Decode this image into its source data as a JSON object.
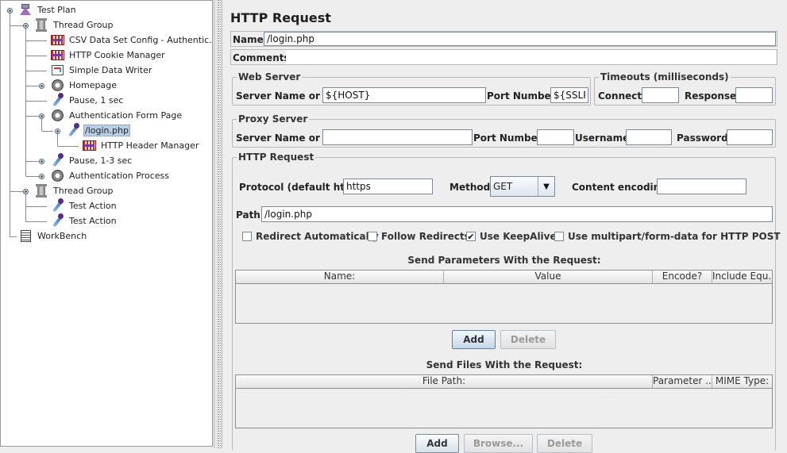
{
  "tree": {
    "items": [
      {
        "label": "Test Plan",
        "icon": "flask-icon"
      },
      {
        "label": "Thread Group",
        "icon": "spool-icon"
      },
      {
        "label": "CSV Data Set Config - Authentic...",
        "icon": "config-icon"
      },
      {
        "label": "HTTP Cookie Manager",
        "icon": "config-icon"
      },
      {
        "label": "Simple Data Writer",
        "icon": "writer-icon"
      },
      {
        "label": "Homepage",
        "icon": "gear-icon"
      },
      {
        "label": "Pause, 1 sec",
        "icon": "pipette-icon"
      },
      {
        "label": "Authentication Form Page",
        "icon": "gear-icon"
      },
      {
        "label": "/login.php",
        "icon": "pipette-icon",
        "selected": true
      },
      {
        "label": "HTTP Header Manager",
        "icon": "config-icon"
      },
      {
        "label": "Pause, 1-3 sec",
        "icon": "pipette-icon"
      },
      {
        "label": "Authentication Process",
        "icon": "gear-icon"
      },
      {
        "label": "Thread Group",
        "icon": "spool-icon"
      },
      {
        "label": "Test Action",
        "icon": "pipette-icon"
      },
      {
        "label": "Test Action",
        "icon": "pipette-icon"
      },
      {
        "label": "WorkBench",
        "icon": "bench-icon"
      }
    ]
  },
  "panel": {
    "title": "HTTP Request",
    "name_label": "Name:",
    "name_value": "/login.php",
    "comments_label": "Comments:",
    "comments_value": ""
  },
  "web_server": {
    "title": "Web Server",
    "server_label": "Server Name or IP:",
    "server_value": "${HOST}",
    "port_label": "Port Number:",
    "port_value": "${SSLP("
  },
  "timeouts": {
    "title": "Timeouts (milliseconds)",
    "connect_label": "Connect:",
    "connect_value": "",
    "response_label": "Response:",
    "response_value": ""
  },
  "proxy": {
    "title": "Proxy Server",
    "server_label": "Server Name or IP:",
    "server_value": "",
    "port_label": "Port Number:",
    "port_value": "",
    "username_label": "Username",
    "username_value": "",
    "password_label": "Password",
    "password_value": ""
  },
  "http": {
    "title": "HTTP Request",
    "protocol_label": "Protocol (default http):",
    "protocol_value": "https",
    "method_label": "Method:",
    "method_value": "GET",
    "encoding_label": "Content encoding:",
    "encoding_value": "",
    "path_label": "Path:",
    "path_value": "/login.php",
    "checkboxes": [
      {
        "label": "Redirect Automatically",
        "checked": false,
        "mark": ""
      },
      {
        "label": "Follow Redirects",
        "checked": false,
        "mark": ""
      },
      {
        "label": "Use KeepAlive",
        "checked": true,
        "mark": "✔"
      },
      {
        "label": "Use multipart/form-data for HTTP POST",
        "checked": false,
        "mark": ""
      }
    ],
    "params_title": "Send Parameters With the Request:",
    "params_columns": [
      "Name:",
      "Value",
      "Encode?",
      "Include Equ..."
    ],
    "add_label": "Add",
    "delete_label": "Delete",
    "files_title": "Send Files With the Request:",
    "files_columns": [
      "File Path:",
      "Parameter ...",
      "MIME Type:"
    ],
    "files_add_label": "Add",
    "browse_label": "Browse...",
    "files_delete_label": "Delete"
  }
}
